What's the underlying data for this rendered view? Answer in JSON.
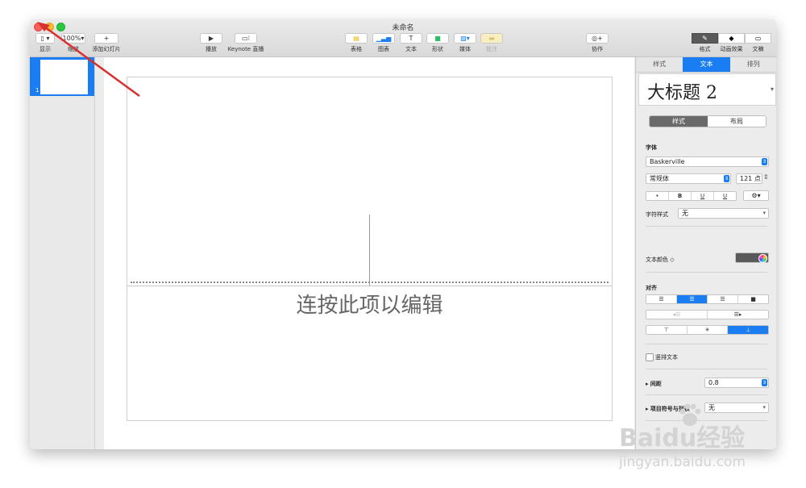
{
  "window": {
    "title": "未命名"
  },
  "toolbar": {
    "view_label": "显示",
    "zoom_value": "100%",
    "zoom_label": "缩放",
    "add_slide_label": "添加幻灯片",
    "play_label": "播放",
    "keynote_live_label": "Keynote 直播",
    "table_label": "表格",
    "chart_label": "图表",
    "text_label": "文本",
    "shape_label": "形状",
    "media_label": "媒体",
    "comment_label": "批注",
    "collaborate_label": "协作",
    "format_label": "格式",
    "animate_label": "动画效果",
    "document_label": "文稿"
  },
  "navigator": {
    "slide_number": "1"
  },
  "slide": {
    "body_placeholder": "连按此项以编辑"
  },
  "inspector": {
    "tabs": [
      "样式",
      "文本",
      "排列"
    ],
    "paragraph_style": "大标题 2",
    "subtabs": [
      "样式",
      "布局"
    ],
    "font_header": "字体",
    "font_name": "Baskerville",
    "font_weight": "常规体",
    "font_size": "121 点",
    "format_buttons": [
      "•",
      "B",
      "U",
      "U"
    ],
    "gear": "⚙",
    "char_style_label": "字符样式",
    "char_style_value": "无",
    "text_color_label": "文本颜色 ◇",
    "align_header": "对齐",
    "vertical_text_label": "竖排文本",
    "spacing_label": "间距",
    "spacing_value": "0.8",
    "bullets_label": "项目符号与列表",
    "bullets_value": "无"
  },
  "watermark": {
    "brand": "Baidu经验",
    "url": "jingyan.baidu.com"
  },
  "colors": {
    "accent": "#1a7ef2",
    "arrow": "#d93030"
  }
}
